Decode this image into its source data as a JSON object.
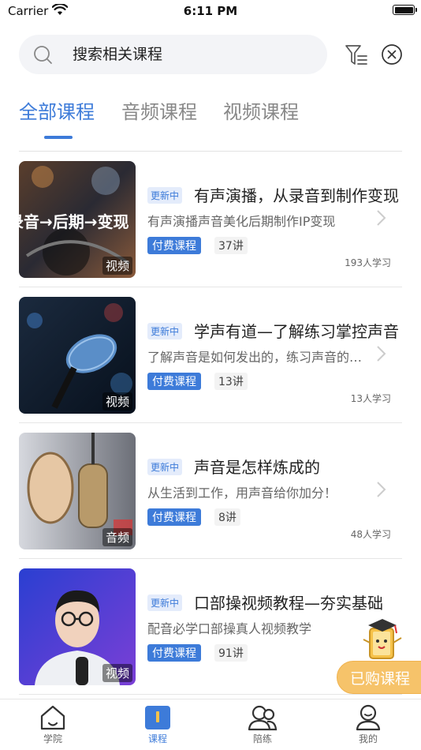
{
  "status_bar": {
    "carrier": "Carrier",
    "time": "6:11 PM"
  },
  "search": {
    "placeholder": "搜索相关课程"
  },
  "tabs": [
    {
      "label": "全部课程",
      "active": true
    },
    {
      "label": "音频课程",
      "active": false
    },
    {
      "label": "视频课程",
      "active": false
    }
  ],
  "courses": [
    {
      "badge": "更新中",
      "title": "有声演播，从录音到制作变现",
      "subtitle": "有声演播声音美化后期制作IP变现",
      "paid_label": "付费课程",
      "lectures": "37讲",
      "learners": "193人学习",
      "media_type": "视频",
      "thumb_text": "录音→后期→变现"
    },
    {
      "badge": "更新中",
      "title": "学声有道—了解练习掌控声音",
      "subtitle": "了解声音是如何发出的，练习声音的技巧",
      "paid_label": "付费课程",
      "lectures": "13讲",
      "learners": "13人学习",
      "media_type": "视频"
    },
    {
      "badge": "更新中",
      "title": "声音是怎样炼成的",
      "subtitle": "从生活到工作，用声音给你加分！",
      "paid_label": "付费课程",
      "lectures": "8讲",
      "learners": "48人学习",
      "media_type": "音频"
    },
    {
      "badge": "更新中",
      "title": "口部操视频教程—夯实基础",
      "subtitle": "配音必学口部操真人视频教学",
      "paid_label": "付费课程",
      "lectures": "91讲",
      "learners": "",
      "media_type": "视频"
    }
  ],
  "floating": {
    "purchased_label": "已购课程"
  },
  "tab_bar": [
    {
      "label": "学院",
      "icon": "home-icon",
      "active": false
    },
    {
      "label": "课程",
      "icon": "book-icon",
      "active": true
    },
    {
      "label": "陪练",
      "icon": "people-icon",
      "active": false
    },
    {
      "label": "我的",
      "icon": "profile-icon",
      "active": false
    }
  ],
  "colors": {
    "accent": "#3d7bd9",
    "floating_button": "#f6c36a"
  }
}
